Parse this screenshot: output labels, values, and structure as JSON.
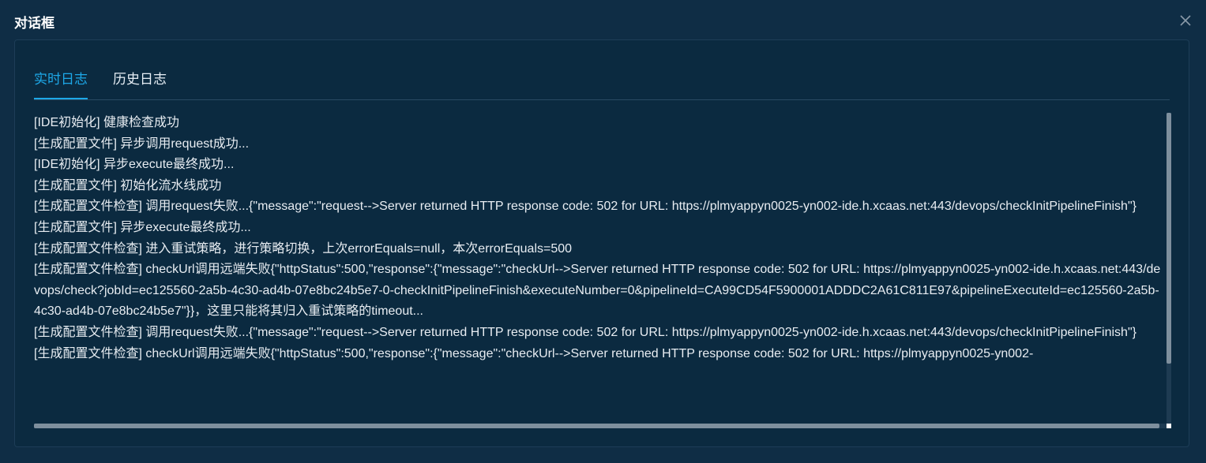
{
  "dialog": {
    "title": "对话框"
  },
  "tabs": [
    {
      "label": "实时日志",
      "active": true
    },
    {
      "label": "历史日志",
      "active": false
    }
  ],
  "colors": {
    "background": "#0f2d45",
    "panel": "#0b2a40",
    "accent": "#1da8e8",
    "text": "#e8edf2"
  },
  "icons": {
    "close": "close-icon"
  },
  "log": {
    "lines": [
      "[IDE初始化] 健康检查成功",
      "[生成配置文件] 异步调用request成功...",
      "[IDE初始化] 异步execute最终成功...",
      "[生成配置文件] 初始化流水线成功",
      "[生成配置文件检查] 调用request失败...{\"message\":\"request-->Server returned HTTP response code: 502 for URL: https://plmyappyn0025-yn002-ide.h.xcaas.net:443/devops/checkInitPipelineFinish\"}",
      "[生成配置文件] 异步execute最终成功...",
      "[生成配置文件检查] 进入重试策略，进行策略切换，上次errorEquals=null，本次errorEquals=500",
      "[生成配置文件检查] checkUrl调用远端失败{\"httpStatus\":500,\"response\":{\"message\":\"checkUrl-->Server returned HTTP response code: 502 for URL: https://plmyappyn0025-yn002-ide.h.xcaas.net:443/devops/check?jobId=ec125560-2a5b-4c30-ad4b-07e8bc24b5e7-0-checkInitPipelineFinish&executeNumber=0&pipelineId=CA99CD54F5900001ADDDC2A61C811E97&pipelineExecuteId=ec125560-2a5b-4c30-ad4b-07e8bc24b5e7\"}}，这里只能将其归入重试策略的timeout...",
      "[生成配置文件检查] 调用request失败...{\"message\":\"request-->Server returned HTTP response code: 502 for URL: https://plmyappyn0025-yn002-ide.h.xcaas.net:443/devops/checkInitPipelineFinish\"}",
      "[生成配置文件检查] checkUrl调用远端失败{\"httpStatus\":500,\"response\":{\"message\":\"checkUrl-->Server returned HTTP response code: 502 for URL: https://plmyappyn0025-yn002-"
    ]
  }
}
